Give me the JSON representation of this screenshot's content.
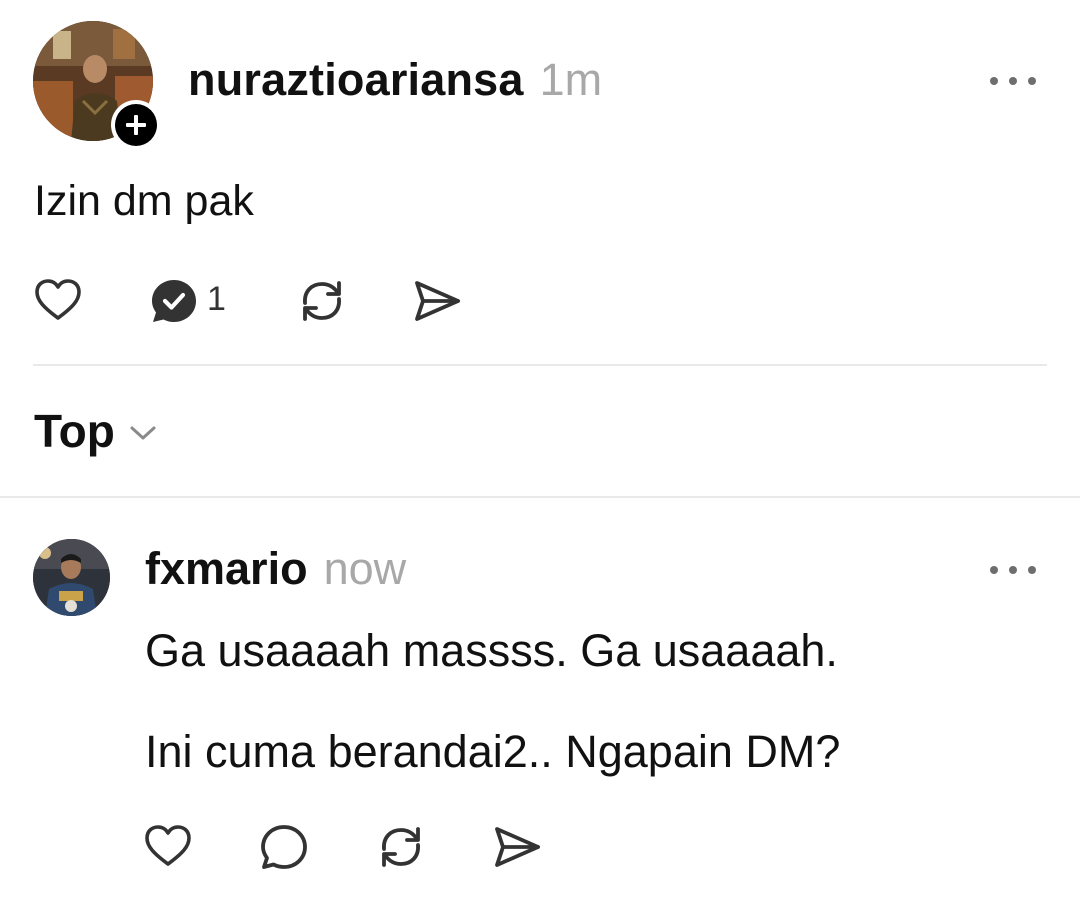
{
  "post": {
    "username": "nuraztioariansa",
    "time": "1m",
    "text": "Izin dm pak",
    "reply_count": "1",
    "icons": {
      "like": "heart-icon",
      "reply": "speech-bubble-check-icon",
      "repost": "repost-arrows-icon",
      "share": "send-icon",
      "more": "more-dots-icon",
      "follow": "plus-icon"
    }
  },
  "sort": {
    "label": "Top",
    "icon": "chevron-down-icon"
  },
  "reply": {
    "username": "fxmario",
    "time": "now",
    "lines": [
      "Ga usaaaah massss. Ga usaaaah.",
      "Ini cuma berandai2.. Ngapain DM?"
    ],
    "icons": {
      "like": "heart-icon",
      "reply": "speech-bubble-icon",
      "repost": "repost-arrows-icon",
      "share": "send-icon",
      "more": "more-dots-icon"
    }
  },
  "colors": {
    "text": "#111111",
    "muted": "#a8a8a8",
    "icon": "#333333",
    "divider": "#e9e9e9"
  }
}
